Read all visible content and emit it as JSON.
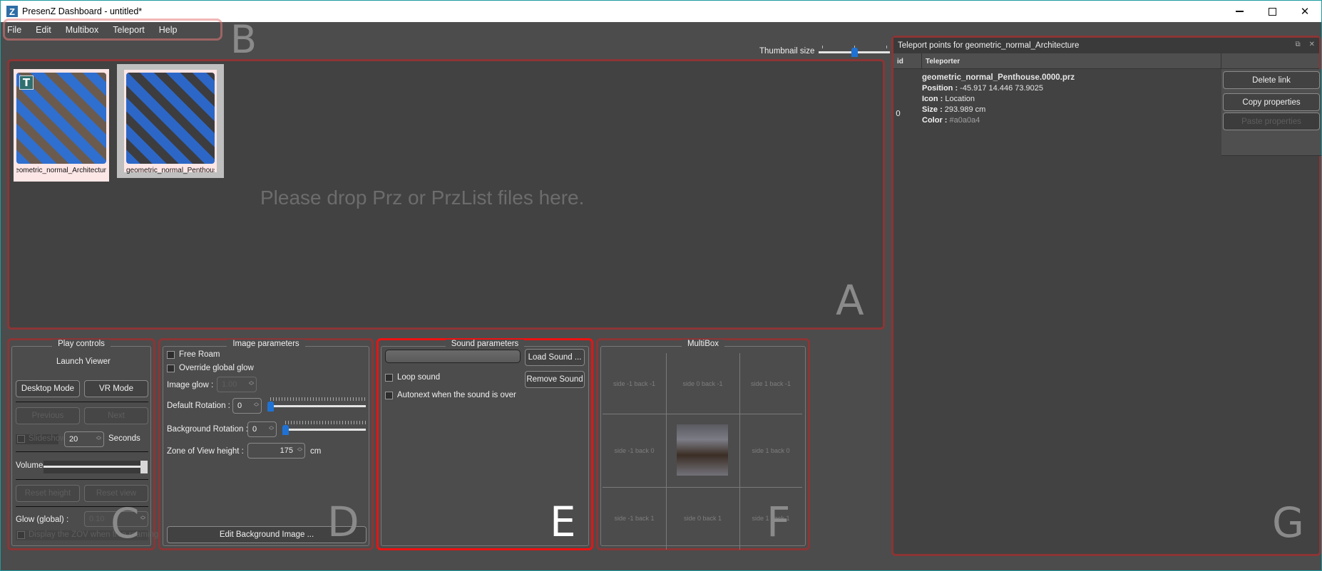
{
  "window": {
    "title": "PresenZ Dashboard - untitled*",
    "logo_letter": "Z"
  },
  "menu": {
    "items": [
      "File",
      "Edit",
      "Multibox",
      "Teleport",
      "Help"
    ]
  },
  "region_labels": {
    "a": "A",
    "b": "B",
    "c": "C",
    "d": "D",
    "e": "E",
    "f": "F",
    "g": "G"
  },
  "thumbnail_size": {
    "label": "Thumbnail size",
    "value_fraction": 0.5
  },
  "drop_area": {
    "hint": "Please drop Prz or PrzList files here.",
    "thumbnails": [
      {
        "label": "geometric_normal_Architectur",
        "badge": "T",
        "selected": false
      },
      {
        "label": "geometric_normal_Penthouse",
        "badge": "",
        "selected": true
      }
    ]
  },
  "play_controls": {
    "title": "Play controls",
    "launch_viewer": "Launch Viewer",
    "desktop_mode": "Desktop Mode",
    "vr_mode": "VR Mode",
    "previous": "Previous",
    "next": "Next",
    "slideshow_label": "Slideshow",
    "slideshow_seconds": "20",
    "seconds_label": "Seconds",
    "volume_label": "Volume",
    "volume_fraction": 1.0,
    "reset_height": "Reset height",
    "reset_view": "Reset view",
    "glow_label": "Glow (global) :",
    "glow_value": "0.10",
    "display_zov": "Display the ZOV when free roaming"
  },
  "image_parameters": {
    "title": "Image parameters",
    "free_roam": "Free Roam",
    "override_glow": "Override global glow",
    "image_glow_label": "Image glow :",
    "image_glow_value": "1.00",
    "default_rotation_label": "Default Rotation :",
    "default_rotation_value": "0",
    "background_rotation_label": "Background Rotation :",
    "background_rotation_value": "0",
    "zov_height_label": "Zone of View height :",
    "zov_height_value": "175",
    "zov_unit": "cm",
    "edit_bg_button": "Edit Background Image ..."
  },
  "sound_parameters": {
    "title": "Sound parameters",
    "sound_path": "",
    "load_sound": "Load Sound ...",
    "remove_sound": "Remove Sound",
    "loop_sound": "Loop sound",
    "autonext": "Autonext when the sound is over"
  },
  "multibox": {
    "title": "MultiBox",
    "cells": [
      "side -1 back -1",
      "side 0 back -1",
      "side 1 back -1",
      "side -1 back 0",
      "",
      "side 1 back 0",
      "side -1 back 1",
      "side 0 back 1",
      "side 1 back 1"
    ]
  },
  "teleport_panel": {
    "title": "Teleport points for geometric_normal_Architecture",
    "columns": [
      "id",
      "Teleporter"
    ],
    "rows": [
      {
        "id": "0",
        "file": "geometric_normal_Penthouse.0000.prz",
        "position_label": "Position :",
        "position": "-45.917 14.446 73.9025",
        "icon_label": "Icon :",
        "icon": "Location",
        "size_label": "Size :",
        "size": "293.989 cm",
        "color_label": "Color :",
        "color": "#a0a0a4"
      }
    ],
    "actions": {
      "delete_link": "Delete link",
      "copy_properties": "Copy properties",
      "paste_properties": "Paste properties"
    }
  }
}
